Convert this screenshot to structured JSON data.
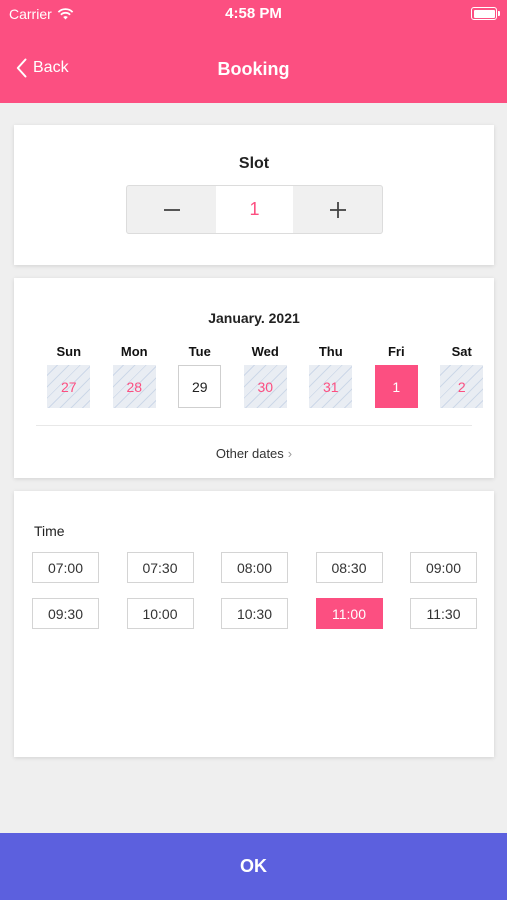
{
  "colors": {
    "accent": "#fc4f81",
    "ok_bar": "#5c60de",
    "background": "#efefef"
  },
  "status_bar": {
    "carrier": "Carrier",
    "time": "4:58 PM"
  },
  "nav": {
    "back_label": "Back",
    "title": "Booking"
  },
  "slot": {
    "label": "Slot",
    "value": "1",
    "minus_icon": "minus",
    "plus_icon": "plus"
  },
  "calendar": {
    "month": "January. 2021",
    "days": [
      "Sun",
      "Mon",
      "Tue",
      "Wed",
      "Thu",
      "Fri",
      "Sat"
    ],
    "dates": [
      {
        "label": "27",
        "state": "past"
      },
      {
        "label": "28",
        "state": "past"
      },
      {
        "label": "29",
        "state": "normal"
      },
      {
        "label": "30",
        "state": "past"
      },
      {
        "label": "31",
        "state": "past"
      },
      {
        "label": "1",
        "state": "selected"
      },
      {
        "label": "2",
        "state": "past"
      }
    ],
    "other_dates": "Other dates"
  },
  "time": {
    "label": "Time",
    "slots": [
      "07:00",
      "07:30",
      "08:00",
      "08:30",
      "09:00",
      "09:30",
      "10:00",
      "10:30",
      "11:00",
      "11:30"
    ],
    "selected": "11:00"
  },
  "footer": {
    "ok_label": "OK"
  }
}
